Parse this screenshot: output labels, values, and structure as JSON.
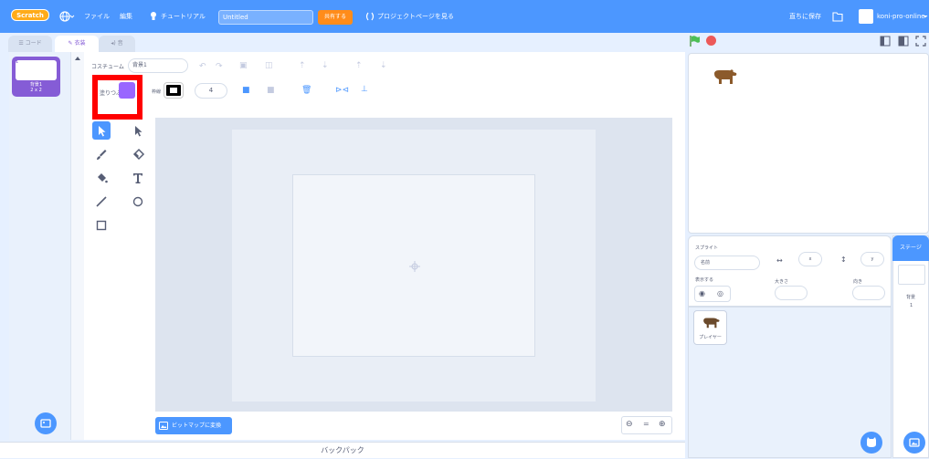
{
  "menubar": {
    "logo": "Scratch",
    "file": "ファイル",
    "edit": "編集",
    "tutorials": "チュートリアル",
    "project_title": "Untitled",
    "share": "共有する",
    "see_project_page": "プロジェクトページを見る",
    "save_now": "直ちに保存",
    "username": "koni-pro-online"
  },
  "tabs": {
    "code": "コード",
    "costumes": "衣装",
    "sounds": "音"
  },
  "costumes": {
    "items": [
      {
        "index": "1",
        "name": "背景1",
        "size": "2 x 2"
      }
    ]
  },
  "paint_toolbar": {
    "costume_label": "コスチューム",
    "costume_name_value": "背景1",
    "fill_label": "塗りつぶし",
    "fill_color": "#9966ff",
    "outline_label": "枠線",
    "stroke_width": "4"
  },
  "paint_editor": {
    "convert_button": "ビットマップに変換",
    "zoom_out": "−",
    "zoom_reset": "=",
    "zoom_in": "+"
  },
  "sprite_info": {
    "sprite_label": "スプライト",
    "name_placeholder": "名前",
    "x_placeholder": "x",
    "y_placeholder": "y",
    "show_label": "表示する",
    "size_label": "大きさ",
    "direction_label": "向き"
  },
  "sprites": {
    "items": [
      {
        "name": "プレイヤー"
      }
    ]
  },
  "stage_panel": {
    "title": "ステージ",
    "backdrops_label": "背景",
    "backdrops_count": "1"
  },
  "backpack": {
    "label": "バックパック"
  },
  "colors": {
    "menubar": "#4c97ff",
    "accent_purple": "#855cd6",
    "share_orange": "#ff8c1a",
    "highlight_red": "#ff0000"
  }
}
